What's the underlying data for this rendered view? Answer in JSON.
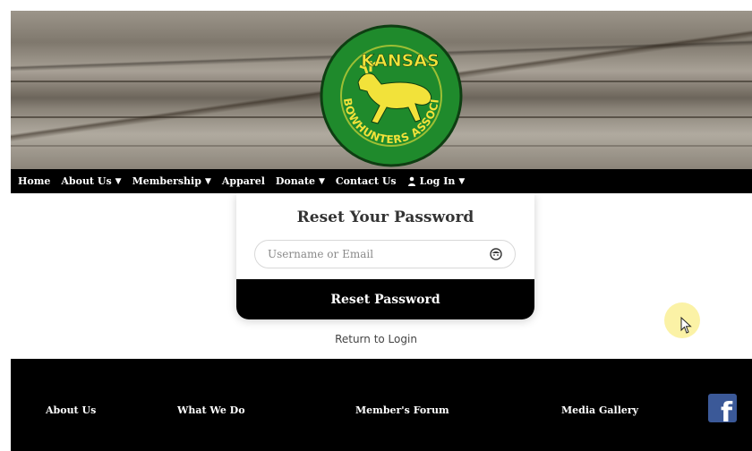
{
  "logo": {
    "top_text": "KANSAS",
    "ring_text": "BOWHUNTERS ASSOCIATION",
    "colors": {
      "green": "#1f8a2c",
      "yellow": "#f2e23a"
    }
  },
  "nav": {
    "items": [
      {
        "label": "Home",
        "has_dropdown": false
      },
      {
        "label": "About Us",
        "has_dropdown": true
      },
      {
        "label": "Membership",
        "has_dropdown": true
      },
      {
        "label": "Apparel",
        "has_dropdown": false
      },
      {
        "label": "Donate",
        "has_dropdown": true
      },
      {
        "label": "Contact Us",
        "has_dropdown": false
      },
      {
        "label": "Log In",
        "has_dropdown": true,
        "icon": "user-icon"
      }
    ],
    "chevron": "⌄"
  },
  "reset": {
    "title": "Reset Your Password",
    "input_placeholder": "Username or Email",
    "input_value": "",
    "button_label": "Reset Password",
    "return_link": "Return to Login"
  },
  "footer": {
    "links": [
      "About Us",
      "What We Do",
      "Member's Forum",
      "Media Gallery"
    ],
    "social_icon": "facebook-icon",
    "social_glyph": "f"
  }
}
